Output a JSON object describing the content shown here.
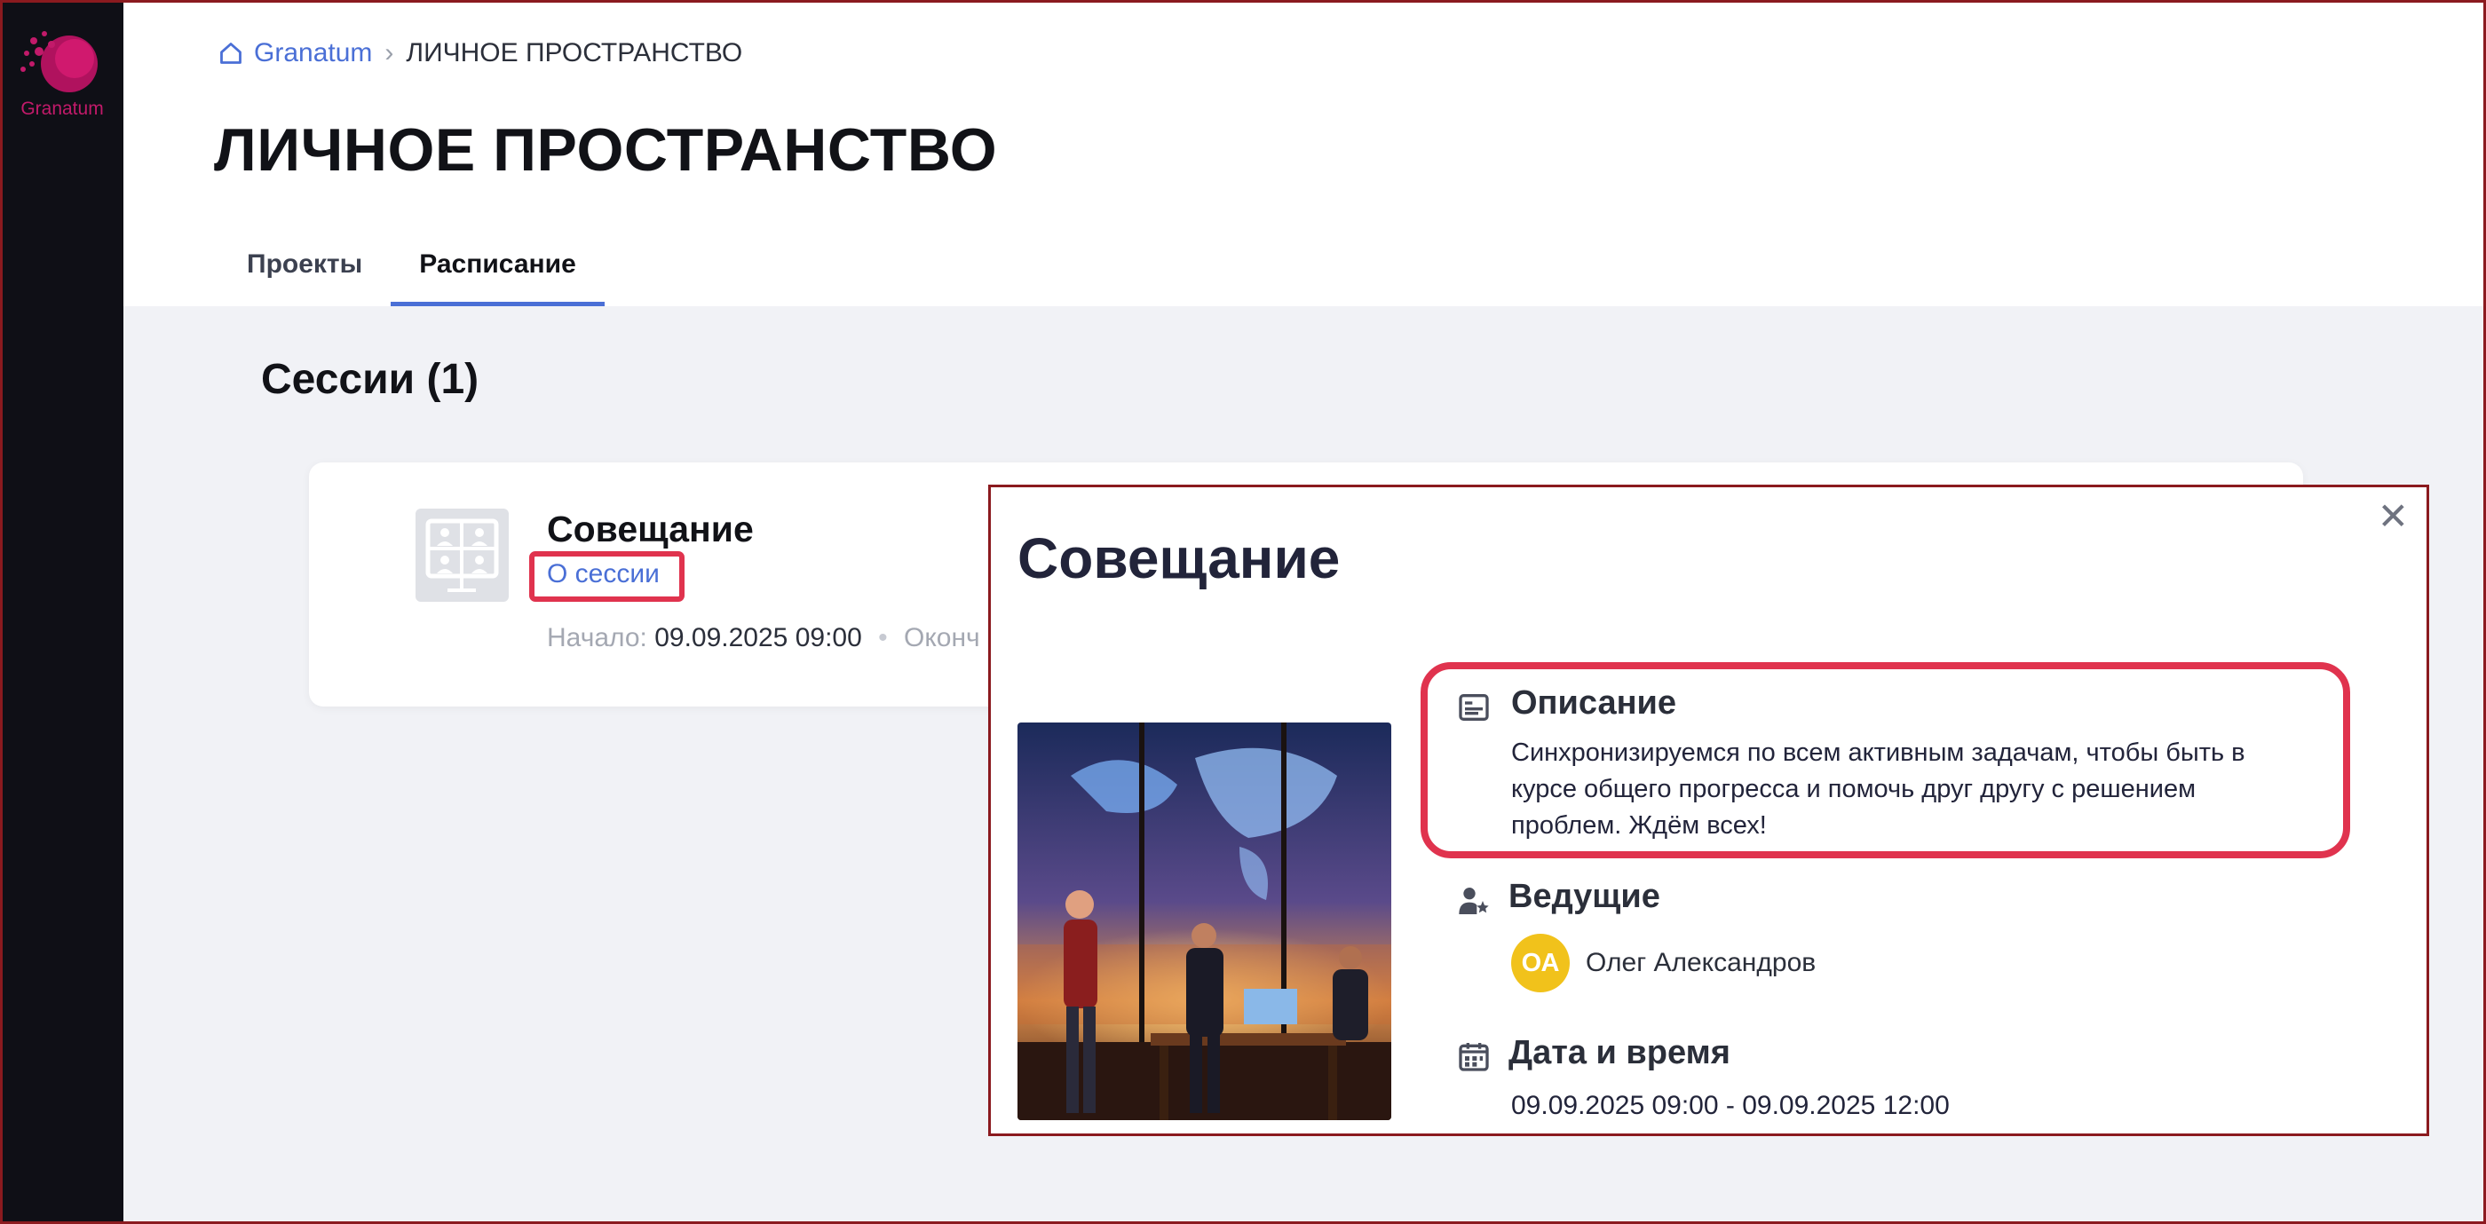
{
  "sidebar": {
    "logo_text": "Granatum"
  },
  "breadcrumb": {
    "home": "Granatum",
    "separator": "›",
    "current": "ЛИЧНОЕ ПРОСТРАНСТВО"
  },
  "page": {
    "title": "ЛИЧНОЕ ПРОСТРАНСТВО"
  },
  "tabs": [
    {
      "label": "Проекты",
      "active": false
    },
    {
      "label": "Расписание",
      "active": true
    }
  ],
  "sessions": {
    "title": "Сессии (1)",
    "card": {
      "name": "Совещание",
      "about_link": "О сессии",
      "start_label": "Начало:",
      "start_value": "09.09.2025 09:00",
      "end_label": "Оконч"
    }
  },
  "modal": {
    "title": "Совещание",
    "close_glyph": "✕",
    "description": {
      "heading": "Описание",
      "text": "Синхронизируемся по всем активным задачам, чтобы быть в курсе общего прогресса и помочь друг другу с решением проблем. Ждём всех!"
    },
    "hosts": {
      "heading": "Ведущие",
      "items": [
        {
          "initials": "ОА",
          "name": "Олег Александров"
        }
      ]
    },
    "datetime": {
      "heading": "Дата и время",
      "value": "09.09.2025 09:00 - 09.09.2025 12:00"
    }
  },
  "colors": {
    "accent": "#4a6fd6",
    "highlight": "#e0334e",
    "sidebar": "#0f0f16",
    "avatar": "#f1c21b"
  }
}
